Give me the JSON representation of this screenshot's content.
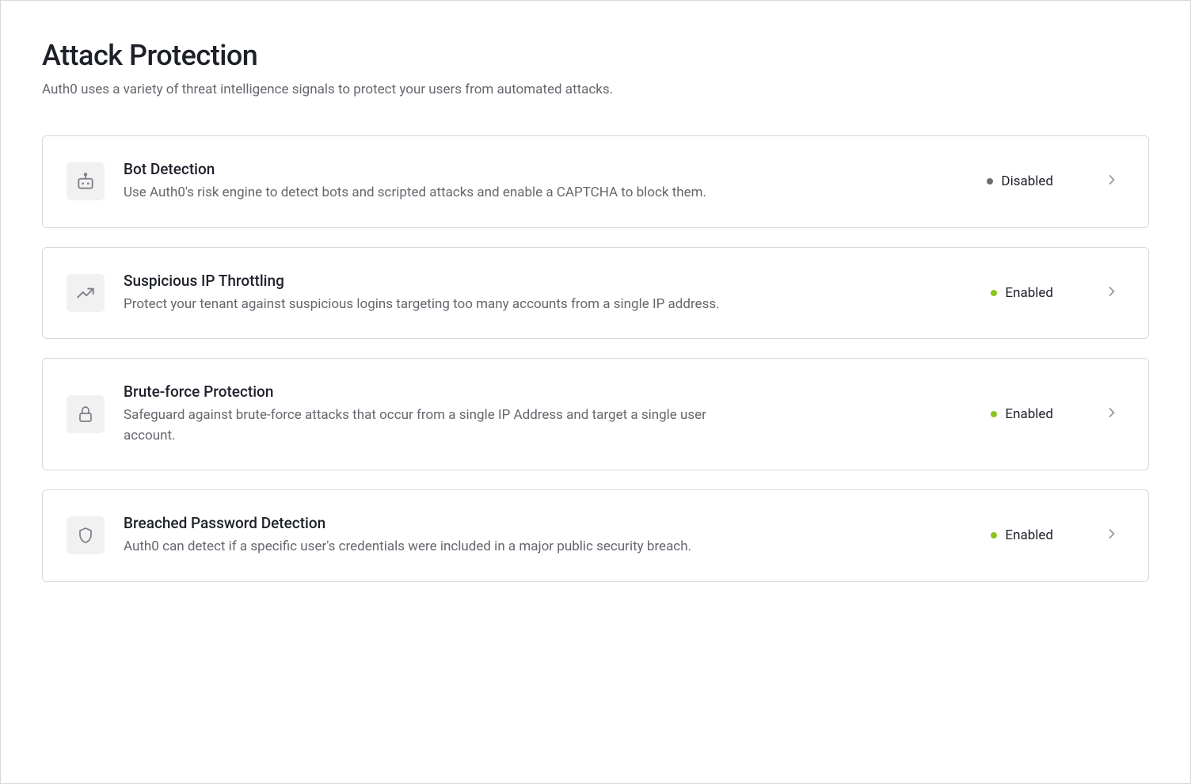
{
  "header": {
    "title": "Attack Protection",
    "subtitle": "Auth0 uses a variety of threat intelligence signals to protect your users from automated attacks."
  },
  "status_labels": {
    "enabled": "Enabled",
    "disabled": "Disabled"
  },
  "cards": {
    "bot": {
      "title": "Bot Detection",
      "description": "Use Auth0's risk engine to detect bots and scripted attacks and enable a CAPTCHA to block them.",
      "status": "Disabled"
    },
    "ip": {
      "title": "Suspicious IP Throttling",
      "description": "Protect your tenant against suspicious logins targeting too many accounts from a single IP address.",
      "status": "Enabled"
    },
    "brute": {
      "title": "Brute-force Protection",
      "description": "Safeguard against brute-force attacks that occur from a single IP Address and target a single user account.",
      "status": "Enabled"
    },
    "breached": {
      "title": "Breached Password Detection",
      "description": "Auth0 can detect if a specific user's credentials were included in a major public security breach.",
      "status": "Enabled"
    }
  }
}
